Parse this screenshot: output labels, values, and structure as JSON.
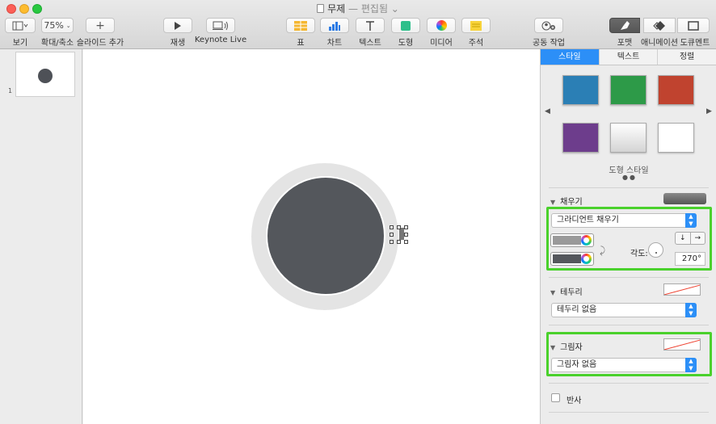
{
  "window": {
    "title": "무제",
    "subtitle": "— 편집됨 ⌄"
  },
  "toolbar": {
    "view_label": "보기",
    "zoom_value": "75%",
    "zoom_label": "확대/축소",
    "add_slide_label": "슬라이드 추가",
    "play_label": "재생",
    "keynote_live_label": "Keynote Live",
    "table_label": "표",
    "chart_label": "차트",
    "text_label": "텍스트",
    "shape_label": "도형",
    "media_label": "미디어",
    "comment_label": "주석",
    "collaborate_label": "공동 작업",
    "format_label": "포맷",
    "animate_label": "애니메이션",
    "document_label": "도큐멘트"
  },
  "navigator": {
    "slide_number": "1"
  },
  "inspector": {
    "tabs": [
      {
        "label": "스타일",
        "active": true
      },
      {
        "label": "텍스트",
        "active": false
      },
      {
        "label": "정렬",
        "active": false
      }
    ],
    "shape_styles_label": "도형 스타일",
    "swatch_colors": [
      "#2b7fb5",
      "#2d9a48",
      "#c0432f",
      "#6d3d8c",
      "#e6e6e6",
      "#ffffff"
    ],
    "fill": {
      "title": "채우기",
      "type_value": "그라디언트 채우기",
      "color1": "#9a9a9a",
      "color2": "#54575c",
      "angle_label": "각도:",
      "angle_value": "270°"
    },
    "border": {
      "title": "테두리",
      "value": "테두리 없음"
    },
    "shadow": {
      "title": "그림자",
      "value": "그림자 없음"
    },
    "reflection": {
      "label": "반사"
    }
  }
}
